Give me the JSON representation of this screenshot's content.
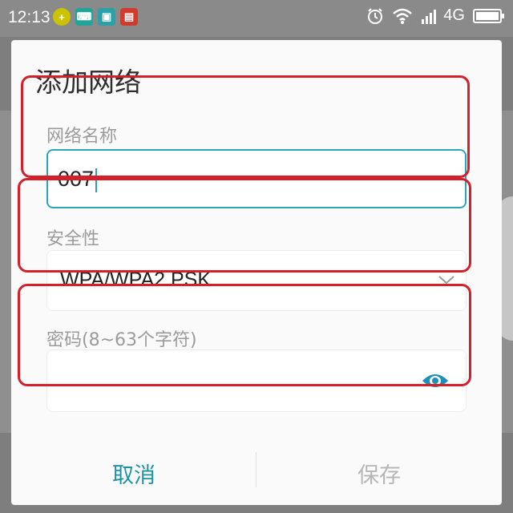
{
  "status_bar": {
    "time": "12:13",
    "network": "4G",
    "icons": [
      "plus-icon",
      "keyboard-icon",
      "scan-icon",
      "red-app-icon",
      "alarm-icon",
      "wifi-icon",
      "signal-icon",
      "battery-icon"
    ]
  },
  "dialog": {
    "title": "添加网络",
    "ssid": {
      "label": "网络名称",
      "value": "007"
    },
    "security": {
      "label": "安全性",
      "value": "WPA/WPA2 PSK"
    },
    "password": {
      "label": "密码(8~63个字符)",
      "value": ""
    },
    "cancel_label": "取消",
    "save_label": "保存"
  },
  "colors": {
    "accent": "#2ba6b8",
    "highlight": "#d5202a",
    "disabled": "#b6b6b6"
  }
}
